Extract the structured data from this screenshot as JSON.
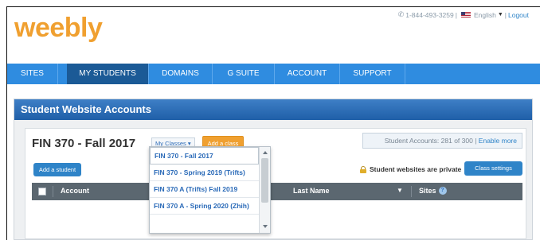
{
  "brand": {
    "logo_text": "weebly",
    "accent_color": "#f0a030"
  },
  "toplinks": {
    "phone": "1-844-493-3259",
    "separator1": "|",
    "language": "English",
    "separator2": "|",
    "logout": "Logout"
  },
  "nav": {
    "items": [
      {
        "label": "SITES",
        "active": false
      },
      {
        "label": "MY STUDENTS",
        "active": true
      },
      {
        "label": "DOMAINS",
        "active": false
      },
      {
        "label": "G SUITE",
        "active": false
      },
      {
        "label": "ACCOUNT",
        "active": false
      },
      {
        "label": "SUPPORT",
        "active": false
      }
    ]
  },
  "panel": {
    "title": "Student Website Accounts"
  },
  "class": {
    "title": "FIN 370 - Fall 2017",
    "my_classes_label": "My Classes",
    "add_class_label": "Add a class"
  },
  "accounts": {
    "text": "Student Accounts: 281 of 300",
    "separator": "|",
    "enable_more": "Enable more"
  },
  "actions": {
    "add_student_label": "Add a student",
    "private_text": "Student websites are private",
    "class_settings_label": "Class settings"
  },
  "table": {
    "columns": {
      "account": "Account",
      "last_name": "Last Name",
      "sites": "Sites"
    }
  },
  "dropdown": {
    "items": [
      "FIN 370 - Fall 2017",
      "FIN 370 - Spring 2019 (Trifts)",
      "FIN 370 A (Trifts) Fall 2019",
      "FIN 370 A - Spring 2020 (Zhih)"
    ]
  }
}
